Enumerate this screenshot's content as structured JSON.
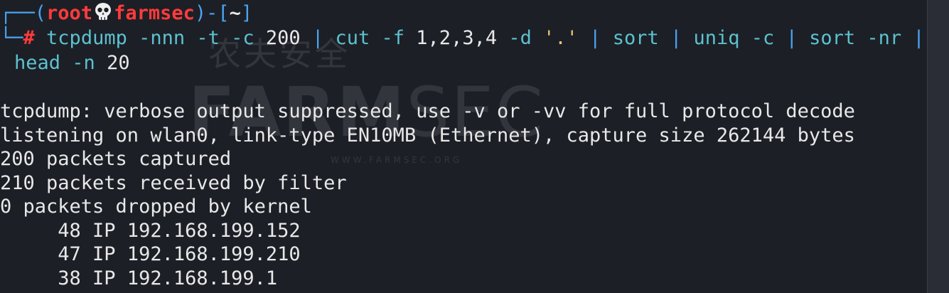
{
  "prompt": {
    "corner_top": "┌──",
    "open": "(",
    "user": "root",
    "skull_icon": "skull-icon",
    "host": "farmsec",
    "close": ")-[",
    "dir": "~",
    "close_bracket": "]",
    "corner_bottom": "└─",
    "hash": "#"
  },
  "command": {
    "tokens_line1": [
      {
        "text": "tcpdump",
        "kind": "cmd"
      },
      {
        "text": " -nnn -t -c ",
        "kind": "flag"
      },
      {
        "text": "200",
        "kind": "arg"
      },
      {
        "text": " | ",
        "kind": "pipe"
      },
      {
        "text": "cut",
        "kind": "cmd"
      },
      {
        "text": " -f ",
        "kind": "flag"
      },
      {
        "text": "1,2,3,4",
        "kind": "arg"
      },
      {
        "text": " -d ",
        "kind": "flag"
      },
      {
        "text": "'.'",
        "kind": "str"
      },
      {
        "text": " | ",
        "kind": "pipe"
      },
      {
        "text": "sort",
        "kind": "cmd"
      },
      {
        "text": " | ",
        "kind": "pipe"
      },
      {
        "text": "uniq",
        "kind": "cmd"
      },
      {
        "text": " -c",
        "kind": "flag"
      },
      {
        "text": " | ",
        "kind": "pipe"
      },
      {
        "text": "sort",
        "kind": "cmd"
      },
      {
        "text": " -nr ",
        "kind": "flag"
      },
      {
        "text": "|",
        "kind": "pipe"
      }
    ],
    "tokens_line2": [
      {
        "text": "head",
        "kind": "cmd"
      },
      {
        "text": " -n ",
        "kind": "flag"
      },
      {
        "text": "20",
        "kind": "arg"
      }
    ]
  },
  "output": [
    "tcpdump: verbose output suppressed, use -v or -vv for full protocol decode",
    "listening on wlan0, link-type EN10MB (Ethernet), capture size 262144 bytes",
    "200 packets captured",
    "210 packets received by filter",
    "0 packets dropped by kernel",
    "     48 IP 192.168.199.152",
    "     47 IP 192.168.199.210",
    "     38 IP 192.168.199.1"
  ],
  "watermark": {
    "cn": "农夫安全",
    "main_bold": "FARM",
    "main_thin": "SEC",
    "url": "WWW.FARMSEC.ORG"
  },
  "colors": {
    "background": "#1c1f26",
    "prompt_frame": "#4aa3f0",
    "user_host": "#ff3b3b",
    "command": "#5dc1cf",
    "string": "#e8c86a",
    "text": "#e8e8e8"
  }
}
